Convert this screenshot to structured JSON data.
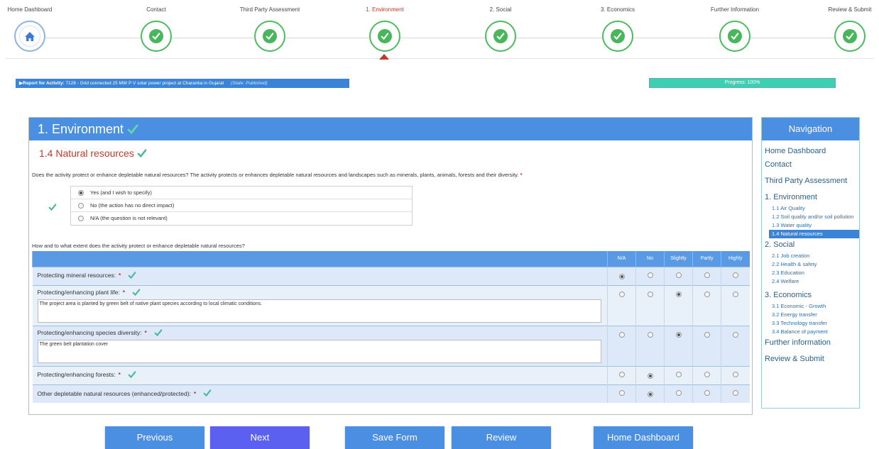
{
  "steps": [
    {
      "label": "Home Dashboard",
      "kind": "home"
    },
    {
      "label": "Contact",
      "kind": "done"
    },
    {
      "label": "Third Party Assessment",
      "kind": "done"
    },
    {
      "label": "1. Environment",
      "kind": "done",
      "active": true
    },
    {
      "label": "2. Social",
      "kind": "done"
    },
    {
      "label": "3. Economics",
      "kind": "done"
    },
    {
      "label": "Further Information",
      "kind": "done"
    },
    {
      "label": "Review & Submit",
      "kind": "done"
    }
  ],
  "report": {
    "prefix": "▶Report for Activity:",
    "activity": "7128 - Grid connected 25 MW P V solar power project at Charanka in Gujarat",
    "state": "(State: Published)"
  },
  "progress": {
    "label": "Progress: 100%",
    "value": 100
  },
  "panel": {
    "title": "1. Environment",
    "section": "1.4 Natural resources",
    "question1": "Does the activity protect or enhance depletable natural resources? The activity protects or enhances depletable natural resources and landscapes such as minerals, plants, animals, forests and their diversity.",
    "radio_options": [
      {
        "label": "Yes (and I wish to specify)",
        "selected": true
      },
      {
        "label": "No (the action has no direct impact)",
        "selected": false
      },
      {
        "label": "N/A (the question is not relevant)",
        "selected": false
      }
    ],
    "question2": "How and to what extent does the activity protect or enhance depletable natural resources?",
    "columns": [
      "N/A",
      "No",
      "Slightly",
      "Partly",
      "Highly"
    ],
    "rows": [
      {
        "label": "Protecting mineral resources:",
        "selected": 0,
        "text": null
      },
      {
        "label": "Protecting/enhancing plant life:",
        "selected": 2,
        "text": "The project area is planted by green belt of native plant species according to local climatic conditions."
      },
      {
        "label": "Protecting/enhancing species diversity:",
        "selected": 2,
        "text": "The green belt plantation cover"
      },
      {
        "label": "Protecting/enhancing forests:",
        "selected": 1,
        "text": null
      },
      {
        "label": "Other depletable natural resources (enhanced/protected):",
        "selected": 1,
        "text": null
      }
    ]
  },
  "nav": {
    "title": "Navigation",
    "items": [
      {
        "label": "Home Dashboard",
        "level": 0
      },
      {
        "label": "Contact",
        "level": 0
      },
      {
        "label": "Third Party Assessment",
        "level": 0,
        "gap": true
      },
      {
        "label": "1. Environment",
        "level": 0,
        "gap": true
      },
      {
        "label": "1.1 Air Quality",
        "level": 1
      },
      {
        "label": "1.2 Soil quality and/or soil pollution",
        "level": 1
      },
      {
        "label": "1.3 Water quality",
        "level": 1
      },
      {
        "label": "1.4 Natural resources",
        "level": 1,
        "active": true
      },
      {
        "label": "2. Social",
        "level": 0
      },
      {
        "label": "2.1 Job creation",
        "level": 1
      },
      {
        "label": "2.2 Health & safety",
        "level": 1
      },
      {
        "label": "2.3 Education",
        "level": 1
      },
      {
        "label": "2.4 Welfare",
        "level": 1
      },
      {
        "label": "3. Economics",
        "level": 0,
        "gap": true
      },
      {
        "label": "3.1 Economic - Growth",
        "level": 1
      },
      {
        "label": "3.2 Energy transfer",
        "level": 1
      },
      {
        "label": "3.3 Technology transfer",
        "level": 1
      },
      {
        "label": "3.4 Balance of payment",
        "level": 1
      },
      {
        "label": "Further information",
        "level": 0
      },
      {
        "label": "Review & Submit",
        "level": 0,
        "gap": true
      }
    ]
  },
  "buttons": {
    "previous": "Previous",
    "next": "Next",
    "save": "Save Form",
    "review": "Review",
    "home": "Home Dashboard"
  },
  "colors": {
    "accent": "#4b8fe2",
    "check": "#48b65a",
    "required": "#c0392b",
    "next": "#5b60f0"
  }
}
